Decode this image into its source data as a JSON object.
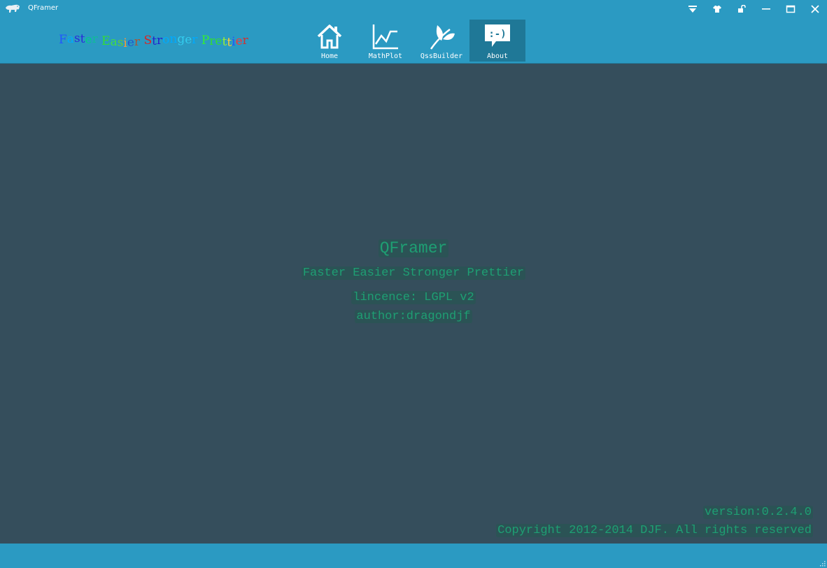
{
  "window": {
    "title": "QFramer",
    "controls": [
      {
        "name": "skin-menu-icon"
      },
      {
        "name": "theme-shirt-icon"
      },
      {
        "name": "unlock-icon"
      },
      {
        "name": "minimize-icon"
      },
      {
        "name": "maximize-icon"
      },
      {
        "name": "close-icon"
      }
    ]
  },
  "header": {
    "slogan_chars": [
      {
        "ch": "F",
        "color": "#2255ff"
      },
      {
        "ch": "a",
        "color": "#00aaff"
      },
      {
        "ch": "s",
        "color": "#2b2bd9"
      },
      {
        "ch": "t",
        "color": "#2b2bd9"
      },
      {
        "ch": "e",
        "color": "#00cc88"
      },
      {
        "ch": "r",
        "color": "#11bb99"
      },
      {
        "ch": " ",
        "color": "#ffffff"
      },
      {
        "ch": "E",
        "color": "#33dd33"
      },
      {
        "ch": "a",
        "color": "#44dd44"
      },
      {
        "ch": "s",
        "color": "#66cc33"
      },
      {
        "ch": "i",
        "color": "#ff9933"
      },
      {
        "ch": "e",
        "color": "#2255cc"
      },
      {
        "ch": "r",
        "color": "#aa5533"
      },
      {
        "ch": " ",
        "color": "#ffffff"
      },
      {
        "ch": "S",
        "color": "#dd2222"
      },
      {
        "ch": "t",
        "color": "#2222cc"
      },
      {
        "ch": "r",
        "color": "#2222cc"
      },
      {
        "ch": "o",
        "color": "#00aaff"
      },
      {
        "ch": "n",
        "color": "#00aaff"
      },
      {
        "ch": "g",
        "color": "#33ccee"
      },
      {
        "ch": "e",
        "color": "#33ccee"
      },
      {
        "ch": "r",
        "color": "#00aaff"
      },
      {
        "ch": " ",
        "color": "#ffffff"
      },
      {
        "ch": "P",
        "color": "#33ee33"
      },
      {
        "ch": "r",
        "color": "#33dd33"
      },
      {
        "ch": "e",
        "color": "#33dd33"
      },
      {
        "ch": "t",
        "color": "#99ee33"
      },
      {
        "ch": "t",
        "color": "#ffcc33"
      },
      {
        "ch": "i",
        "color": "#2255ff"
      },
      {
        "ch": "e",
        "color": "#ff3333"
      },
      {
        "ch": "r",
        "color": "#cc3333"
      }
    ],
    "nav": [
      {
        "label": "Home",
        "icon": "home-icon",
        "active": false
      },
      {
        "label": "MathPlot",
        "icon": "chart-line-icon",
        "active": false
      },
      {
        "label": "QssBuilder",
        "icon": "leaf-icon",
        "active": false
      },
      {
        "label": "About",
        "icon": "smiley-speech-bubble-icon",
        "active": true
      }
    ]
  },
  "about": {
    "title": "QFramer",
    "slogan": "Faster Easier Stronger Prettier",
    "licence": "lincence: LGPL v2",
    "author": "author:dragondjf",
    "version": "version:0.2.4.0",
    "copyright": "Copyright 2012-2014 DJF. All rights reserved"
  },
  "colors": {
    "accent": "#2b9ac2",
    "background": "#354e5c",
    "text_green": "#1e9f73",
    "active_tab": "#1f7897"
  }
}
